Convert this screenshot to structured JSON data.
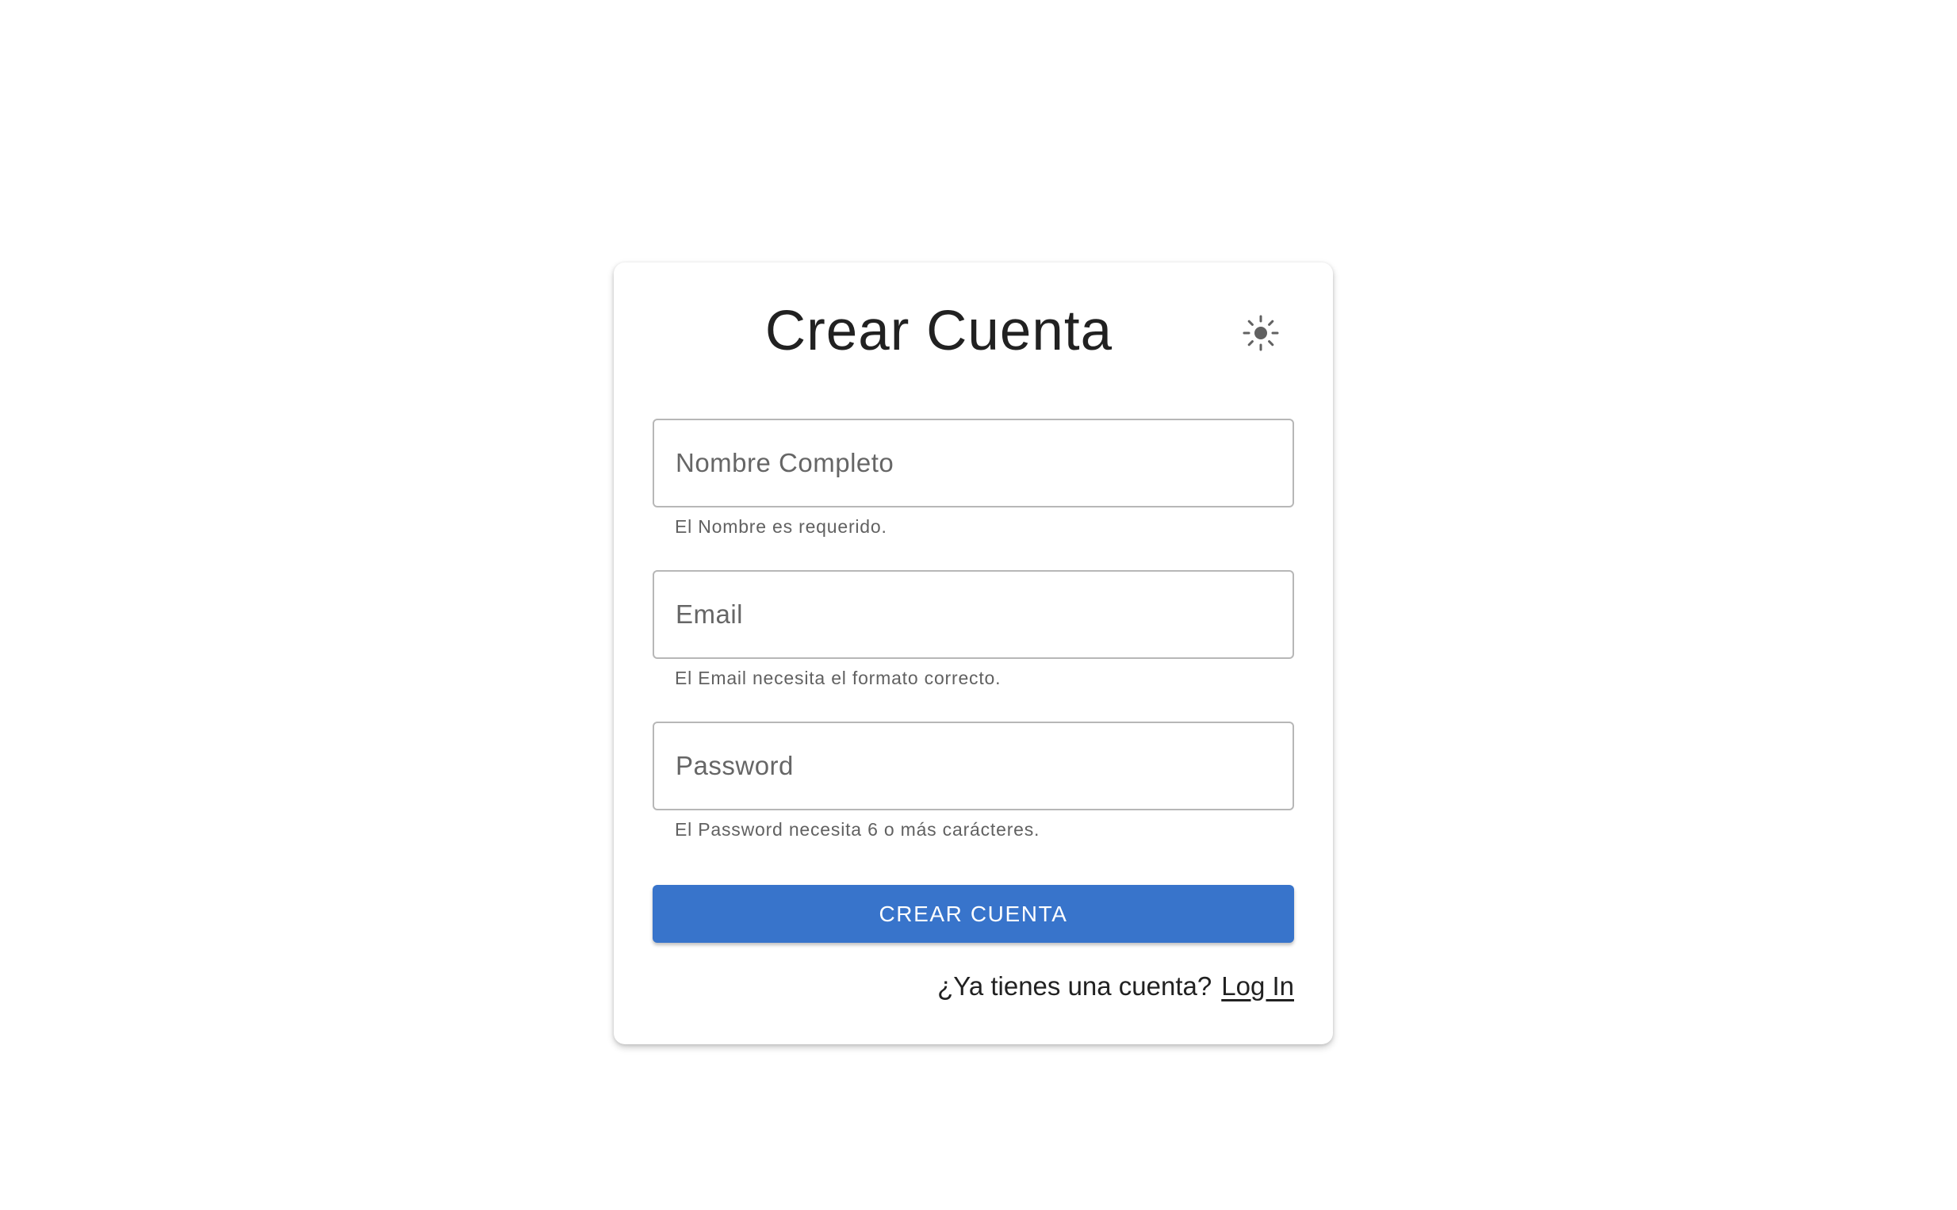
{
  "form": {
    "title": "Crear Cuenta",
    "theme_toggle_icon": "sun-icon",
    "fields": [
      {
        "placeholder": "Nombre Completo",
        "value": "",
        "helper": "El Nombre es requerido."
      },
      {
        "placeholder": "Email",
        "value": "",
        "helper": "El Email necesita el formato correcto."
      },
      {
        "placeholder": "Password",
        "value": "",
        "helper": "El Password necesita 6 o más carácteres."
      }
    ],
    "submit_label": "CREAR CUENTA",
    "footer": {
      "prompt": "¿Ya tienes una cuenta?",
      "link_label": "Log In"
    }
  },
  "colors": {
    "primary": "#3874cb",
    "text": "#212121",
    "helper_text": "#616161",
    "field_border": "#b7b7b7",
    "icon": "#616161",
    "background": "#ffffff"
  }
}
